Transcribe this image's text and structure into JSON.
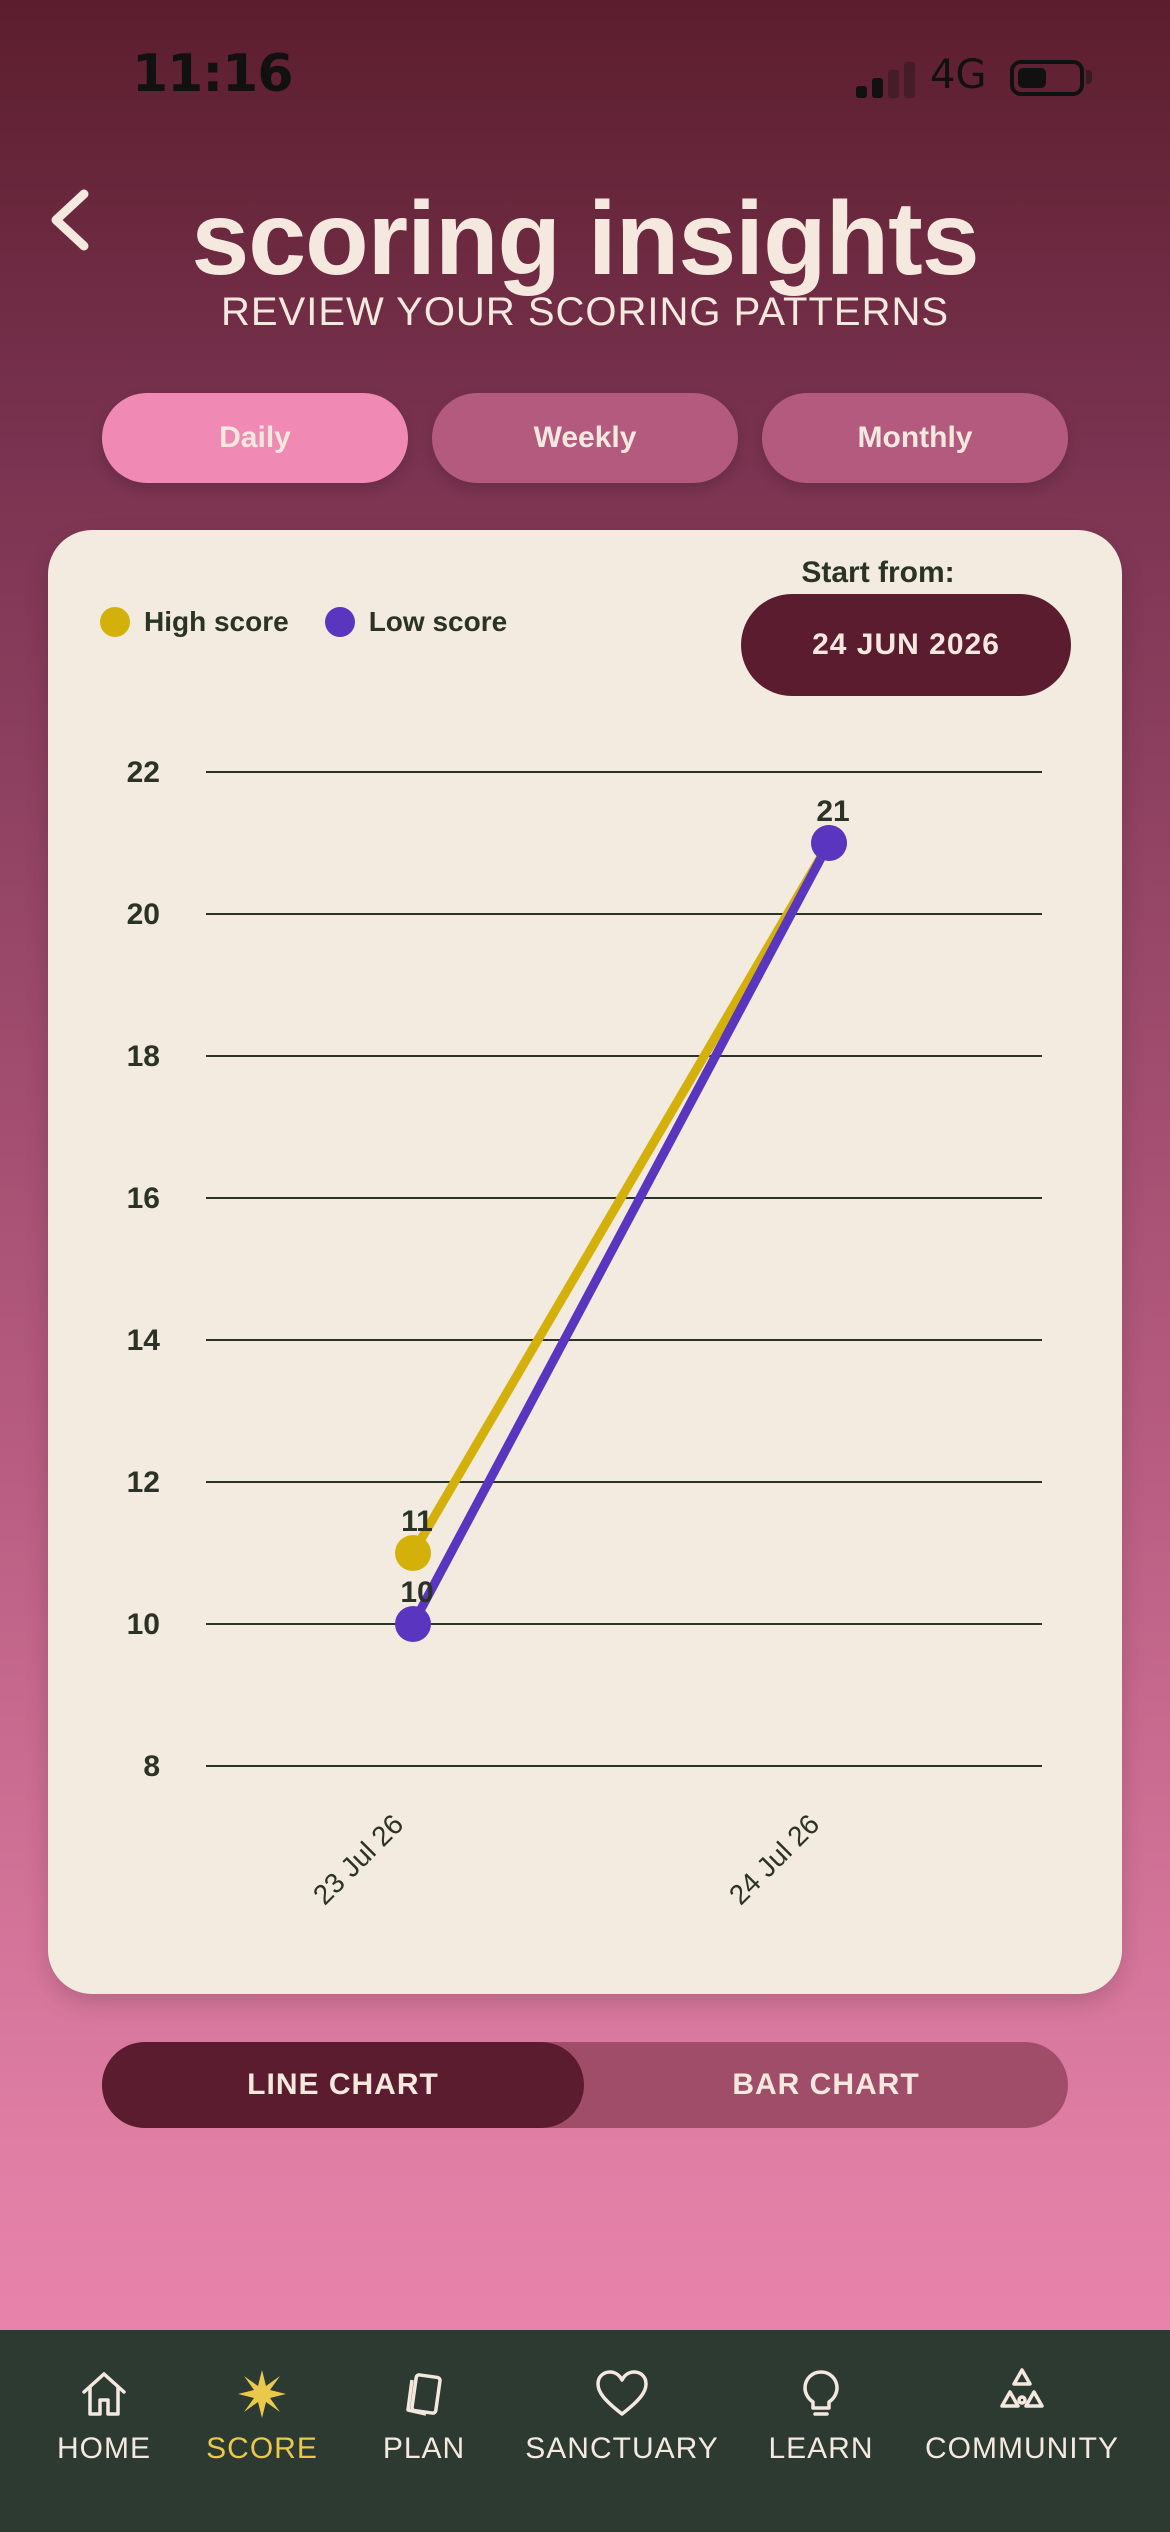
{
  "status": {
    "time": "11:16",
    "network": "4G"
  },
  "header": {
    "title": "scoring insights",
    "subtitle": "REVIEW YOUR SCORING PATTERNS"
  },
  "tabs": [
    {
      "label": "Daily",
      "active": true
    },
    {
      "label": "Weekly",
      "active": false
    },
    {
      "label": "Monthly",
      "active": false
    }
  ],
  "chart_controls": {
    "start_label": "Start from:",
    "start_date": "24 JUN 2026"
  },
  "chart_type_toggle": {
    "line_label": "LINE CHART",
    "bar_label": "BAR CHART",
    "active": "line"
  },
  "colors": {
    "high": "#d4b10a",
    "low": "#5a35c0",
    "accent": "#5a1c2e"
  },
  "chart_data": {
    "type": "line",
    "categories": [
      "23 Jul 26",
      "24 Jul 26"
    ],
    "series": [
      {
        "name": "High score",
        "values": [
          11,
          21
        ]
      },
      {
        "name": "Low score",
        "values": [
          10,
          21
        ]
      }
    ],
    "yticks": [
      8,
      10,
      12,
      14,
      16,
      18,
      20,
      22
    ],
    "ylim": [
      8,
      22
    ],
    "grid": true,
    "legend": "top-left"
  },
  "nav": [
    {
      "label": "HOME",
      "icon": "home-icon",
      "active": false
    },
    {
      "label": "SCORE",
      "icon": "star-icon",
      "active": true
    },
    {
      "label": "PLAN",
      "icon": "cards-icon",
      "active": false
    },
    {
      "label": "SANCTUARY",
      "icon": "heart-icon",
      "active": false
    },
    {
      "label": "LEARN",
      "icon": "lightbulb-icon",
      "active": false
    },
    {
      "label": "COMMUNITY",
      "icon": "community-icon",
      "active": false
    }
  ]
}
